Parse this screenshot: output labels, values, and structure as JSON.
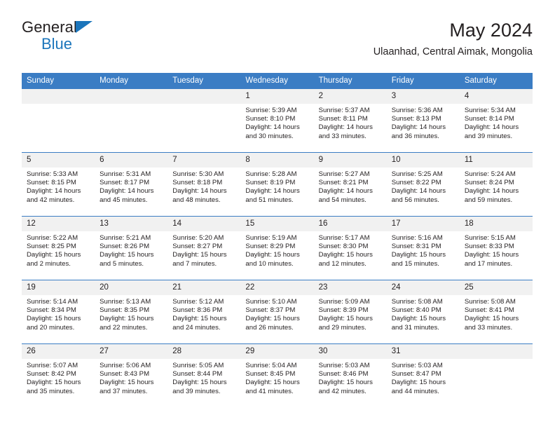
{
  "brand": {
    "line1": "General",
    "line2": "Blue",
    "triangle_icon": "triangle-icon"
  },
  "header": {
    "title": "May 2024",
    "subtitle": "Ulaanhad, Central Aimak, Mongolia"
  },
  "colors": {
    "header_blue": "#3b7dc4",
    "brand_blue": "#1b75bb",
    "daynum_bg": "#f1f1f1",
    "text": "#231f20"
  },
  "weekdays": [
    "Sunday",
    "Monday",
    "Tuesday",
    "Wednesday",
    "Thursday",
    "Friday",
    "Saturday"
  ],
  "weeks": [
    [
      {
        "day": "",
        "sunrise": "",
        "sunset": "",
        "daylight_line1": "",
        "daylight_line2": ""
      },
      {
        "day": "",
        "sunrise": "",
        "sunset": "",
        "daylight_line1": "",
        "daylight_line2": ""
      },
      {
        "day": "",
        "sunrise": "",
        "sunset": "",
        "daylight_line1": "",
        "daylight_line2": ""
      },
      {
        "day": "1",
        "sunrise": "Sunrise: 5:39 AM",
        "sunset": "Sunset: 8:10 PM",
        "daylight_line1": "Daylight: 14 hours",
        "daylight_line2": "and 30 minutes."
      },
      {
        "day": "2",
        "sunrise": "Sunrise: 5:37 AM",
        "sunset": "Sunset: 8:11 PM",
        "daylight_line1": "Daylight: 14 hours",
        "daylight_line2": "and 33 minutes."
      },
      {
        "day": "3",
        "sunrise": "Sunrise: 5:36 AM",
        "sunset": "Sunset: 8:13 PM",
        "daylight_line1": "Daylight: 14 hours",
        "daylight_line2": "and 36 minutes."
      },
      {
        "day": "4",
        "sunrise": "Sunrise: 5:34 AM",
        "sunset": "Sunset: 8:14 PM",
        "daylight_line1": "Daylight: 14 hours",
        "daylight_line2": "and 39 minutes."
      }
    ],
    [
      {
        "day": "5",
        "sunrise": "Sunrise: 5:33 AM",
        "sunset": "Sunset: 8:15 PM",
        "daylight_line1": "Daylight: 14 hours",
        "daylight_line2": "and 42 minutes."
      },
      {
        "day": "6",
        "sunrise": "Sunrise: 5:31 AM",
        "sunset": "Sunset: 8:17 PM",
        "daylight_line1": "Daylight: 14 hours",
        "daylight_line2": "and 45 minutes."
      },
      {
        "day": "7",
        "sunrise": "Sunrise: 5:30 AM",
        "sunset": "Sunset: 8:18 PM",
        "daylight_line1": "Daylight: 14 hours",
        "daylight_line2": "and 48 minutes."
      },
      {
        "day": "8",
        "sunrise": "Sunrise: 5:28 AM",
        "sunset": "Sunset: 8:19 PM",
        "daylight_line1": "Daylight: 14 hours",
        "daylight_line2": "and 51 minutes."
      },
      {
        "day": "9",
        "sunrise": "Sunrise: 5:27 AM",
        "sunset": "Sunset: 8:21 PM",
        "daylight_line1": "Daylight: 14 hours",
        "daylight_line2": "and 54 minutes."
      },
      {
        "day": "10",
        "sunrise": "Sunrise: 5:25 AM",
        "sunset": "Sunset: 8:22 PM",
        "daylight_line1": "Daylight: 14 hours",
        "daylight_line2": "and 56 minutes."
      },
      {
        "day": "11",
        "sunrise": "Sunrise: 5:24 AM",
        "sunset": "Sunset: 8:24 PM",
        "daylight_line1": "Daylight: 14 hours",
        "daylight_line2": "and 59 minutes."
      }
    ],
    [
      {
        "day": "12",
        "sunrise": "Sunrise: 5:22 AM",
        "sunset": "Sunset: 8:25 PM",
        "daylight_line1": "Daylight: 15 hours",
        "daylight_line2": "and 2 minutes."
      },
      {
        "day": "13",
        "sunrise": "Sunrise: 5:21 AM",
        "sunset": "Sunset: 8:26 PM",
        "daylight_line1": "Daylight: 15 hours",
        "daylight_line2": "and 5 minutes."
      },
      {
        "day": "14",
        "sunrise": "Sunrise: 5:20 AM",
        "sunset": "Sunset: 8:27 PM",
        "daylight_line1": "Daylight: 15 hours",
        "daylight_line2": "and 7 minutes."
      },
      {
        "day": "15",
        "sunrise": "Sunrise: 5:19 AM",
        "sunset": "Sunset: 8:29 PM",
        "daylight_line1": "Daylight: 15 hours",
        "daylight_line2": "and 10 minutes."
      },
      {
        "day": "16",
        "sunrise": "Sunrise: 5:17 AM",
        "sunset": "Sunset: 8:30 PM",
        "daylight_line1": "Daylight: 15 hours",
        "daylight_line2": "and 12 minutes."
      },
      {
        "day": "17",
        "sunrise": "Sunrise: 5:16 AM",
        "sunset": "Sunset: 8:31 PM",
        "daylight_line1": "Daylight: 15 hours",
        "daylight_line2": "and 15 minutes."
      },
      {
        "day": "18",
        "sunrise": "Sunrise: 5:15 AM",
        "sunset": "Sunset: 8:33 PM",
        "daylight_line1": "Daylight: 15 hours",
        "daylight_line2": "and 17 minutes."
      }
    ],
    [
      {
        "day": "19",
        "sunrise": "Sunrise: 5:14 AM",
        "sunset": "Sunset: 8:34 PM",
        "daylight_line1": "Daylight: 15 hours",
        "daylight_line2": "and 20 minutes."
      },
      {
        "day": "20",
        "sunrise": "Sunrise: 5:13 AM",
        "sunset": "Sunset: 8:35 PM",
        "daylight_line1": "Daylight: 15 hours",
        "daylight_line2": "and 22 minutes."
      },
      {
        "day": "21",
        "sunrise": "Sunrise: 5:12 AM",
        "sunset": "Sunset: 8:36 PM",
        "daylight_line1": "Daylight: 15 hours",
        "daylight_line2": "and 24 minutes."
      },
      {
        "day": "22",
        "sunrise": "Sunrise: 5:10 AM",
        "sunset": "Sunset: 8:37 PM",
        "daylight_line1": "Daylight: 15 hours",
        "daylight_line2": "and 26 minutes."
      },
      {
        "day": "23",
        "sunrise": "Sunrise: 5:09 AM",
        "sunset": "Sunset: 8:39 PM",
        "daylight_line1": "Daylight: 15 hours",
        "daylight_line2": "and 29 minutes."
      },
      {
        "day": "24",
        "sunrise": "Sunrise: 5:08 AM",
        "sunset": "Sunset: 8:40 PM",
        "daylight_line1": "Daylight: 15 hours",
        "daylight_line2": "and 31 minutes."
      },
      {
        "day": "25",
        "sunrise": "Sunrise: 5:08 AM",
        "sunset": "Sunset: 8:41 PM",
        "daylight_line1": "Daylight: 15 hours",
        "daylight_line2": "and 33 minutes."
      }
    ],
    [
      {
        "day": "26",
        "sunrise": "Sunrise: 5:07 AM",
        "sunset": "Sunset: 8:42 PM",
        "daylight_line1": "Daylight: 15 hours",
        "daylight_line2": "and 35 minutes."
      },
      {
        "day": "27",
        "sunrise": "Sunrise: 5:06 AM",
        "sunset": "Sunset: 8:43 PM",
        "daylight_line1": "Daylight: 15 hours",
        "daylight_line2": "and 37 minutes."
      },
      {
        "day": "28",
        "sunrise": "Sunrise: 5:05 AM",
        "sunset": "Sunset: 8:44 PM",
        "daylight_line1": "Daylight: 15 hours",
        "daylight_line2": "and 39 minutes."
      },
      {
        "day": "29",
        "sunrise": "Sunrise: 5:04 AM",
        "sunset": "Sunset: 8:45 PM",
        "daylight_line1": "Daylight: 15 hours",
        "daylight_line2": "and 41 minutes."
      },
      {
        "day": "30",
        "sunrise": "Sunrise: 5:03 AM",
        "sunset": "Sunset: 8:46 PM",
        "daylight_line1": "Daylight: 15 hours",
        "daylight_line2": "and 42 minutes."
      },
      {
        "day": "31",
        "sunrise": "Sunrise: 5:03 AM",
        "sunset": "Sunset: 8:47 PM",
        "daylight_line1": "Daylight: 15 hours",
        "daylight_line2": "and 44 minutes."
      },
      {
        "day": "",
        "sunrise": "",
        "sunset": "",
        "daylight_line1": "",
        "daylight_line2": ""
      }
    ]
  ]
}
